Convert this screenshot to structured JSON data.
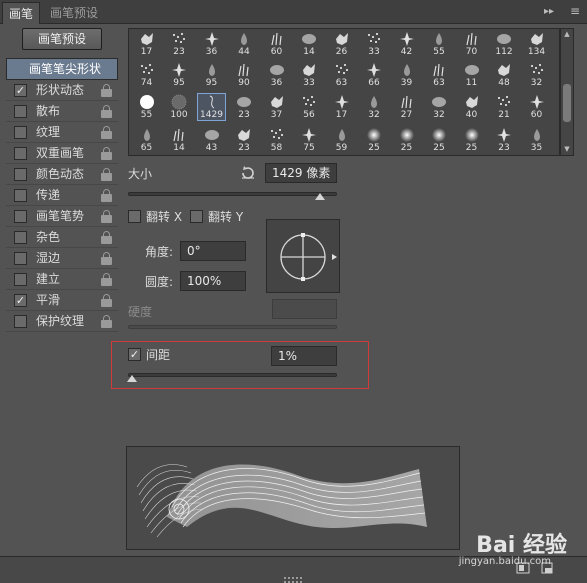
{
  "tabs": [
    {
      "label": "画笔"
    },
    {
      "label": "画笔预设"
    }
  ],
  "tab_controls": {
    "collapse": "▸▸",
    "menu": "≡"
  },
  "preset_button": "画笔预设",
  "left_list": {
    "header": "画笔笔尖形状",
    "items": [
      {
        "label": "形状动态",
        "checked": true
      },
      {
        "label": "散布",
        "checked": false
      },
      {
        "label": "纹理",
        "checked": false
      },
      {
        "label": "双重画笔",
        "checked": false
      },
      {
        "label": "颜色动态",
        "checked": false
      },
      {
        "label": "传递",
        "checked": false
      },
      {
        "label": "画笔笔势",
        "checked": false
      },
      {
        "label": "杂色",
        "checked": false
      },
      {
        "label": "湿边",
        "checked": false
      },
      {
        "label": "建立",
        "checked": false
      },
      {
        "label": "平滑",
        "checked": true
      },
      {
        "label": "保护纹理",
        "checked": false
      }
    ]
  },
  "brush_grid": {
    "rows": [
      [
        "17",
        "23",
        "36",
        "44",
        "60",
        "14",
        "26",
        "33",
        "42",
        "55",
        "70",
        "112",
        "134"
      ],
      [
        "74",
        "95",
        "95",
        "90",
        "36",
        "33",
        "63",
        "66",
        "39",
        "63",
        "11",
        "48",
        "32"
      ],
      [
        "55",
        "100",
        "1429",
        "23",
        "37",
        "56",
        "17",
        "32",
        "27",
        "32",
        "40",
        "21",
        "60"
      ],
      [
        "65",
        "14",
        "43",
        "23",
        "58",
        "75",
        "59",
        "25",
        "25",
        "25",
        "25",
        "23",
        "35"
      ]
    ],
    "selected": "1429"
  },
  "size": {
    "label": "大小",
    "value": "1429 像素",
    "reset_icon": "reset-icon"
  },
  "flip": {
    "x_label": "翻转 X",
    "y_label": "翻转 Y",
    "x_checked": false,
    "y_checked": false
  },
  "angle": {
    "label": "角度:",
    "value": "0°"
  },
  "roundness": {
    "label": "圆度:",
    "value": "100%"
  },
  "hardness": {
    "label": "硬度"
  },
  "spacing": {
    "label": "间距",
    "value": "1%",
    "checked": true
  },
  "size_slider_fraction": 0.92,
  "spacing_slider_fraction": 0.0,
  "watermark": {
    "text": "Bai 经验",
    "url": "jingyan.baidu.com"
  }
}
